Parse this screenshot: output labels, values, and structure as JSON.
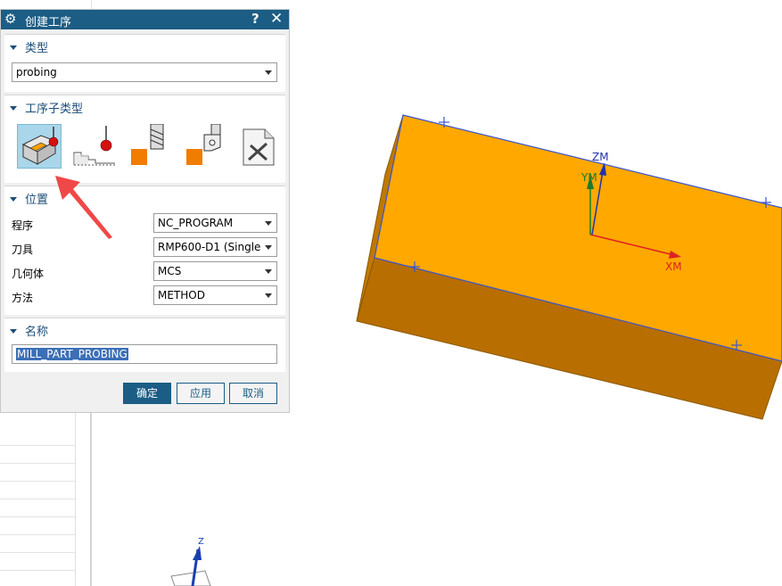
{
  "dialog": {
    "title": "创建工序",
    "help_label": "?",
    "close_label": "✕",
    "gear_icon": "gear-icon"
  },
  "type_section": {
    "header": "类型",
    "value": "probing"
  },
  "subtype_section": {
    "header": "工序子类型",
    "icons": [
      "probe-part-icon",
      "probe-step-icon",
      "probe-tool-length-icon",
      "probe-tool-radius-icon",
      "user-defined-icon"
    ]
  },
  "location_section": {
    "header": "位置",
    "rows": [
      {
        "label": "程序",
        "value": "NC_PROGRAM"
      },
      {
        "label": "刀具",
        "value": "RMP600-D1 (Single"
      },
      {
        "label": "几何体",
        "value": "MCS"
      },
      {
        "label": "方法",
        "value": "METHOD"
      }
    ]
  },
  "name_section": {
    "header": "名称",
    "value": "MILL_PART_PROBING"
  },
  "buttons": {
    "ok": "确定",
    "apply": "应用",
    "cancel": "取消"
  },
  "viewport": {
    "axis_zm": "ZM",
    "axis_ym": "YM",
    "axis_xm": "XM",
    "axis_z": "Z",
    "top_face_color": "#ffa800",
    "side_face_color": "#c07800",
    "front_face_color": "#b86e00"
  }
}
